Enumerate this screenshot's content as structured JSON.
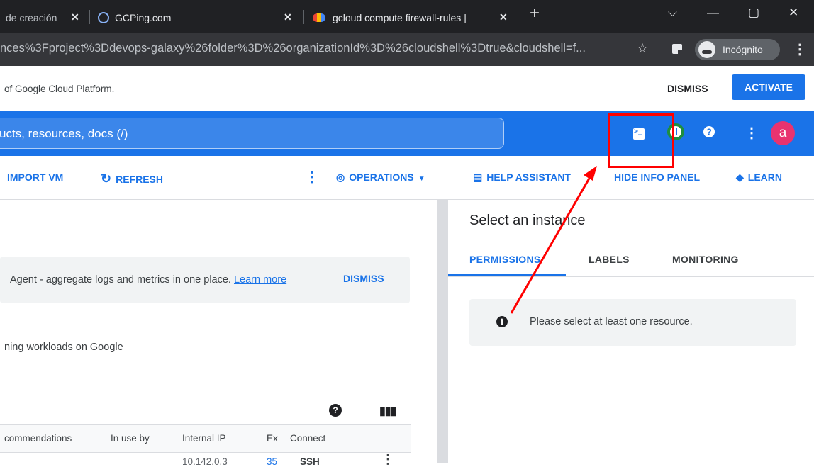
{
  "browser": {
    "tabs": [
      {
        "title": "de creación",
        "close": "✕"
      },
      {
        "title": "GCPing.com",
        "close": "✕"
      },
      {
        "title": "gcloud compute firewall-rules |",
        "close": "✕"
      }
    ],
    "new_tab": "+",
    "window_controls": {
      "minimize": "—",
      "maximize": "▢",
      "close": "✕",
      "dropdown": "⌵"
    },
    "url": "nces%3Fproject%3Ddevops-galaxy%26folder%3D%26organizationId%3D%26cloudshell%3Dtrue&cloudshell=f...",
    "incognito_label": "Incógnito"
  },
  "banner": {
    "text": "of Google Cloud Platform.",
    "dismiss": "DISMISS",
    "activate": "ACTIVATE"
  },
  "header": {
    "search_text": "ucts, resources, docs (/)",
    "help_glyph": "?",
    "avatar_letter": "a"
  },
  "toolbar": {
    "import_vm": "IMPORT VM",
    "refresh": "REFRESH",
    "operations": "OPERATIONS",
    "help_assistant": "HELP ASSISTANT",
    "hide_info_panel": "HIDE INFO PANEL",
    "learn": "LEARN"
  },
  "main": {
    "infobar_text": "Agent - aggregate logs and metrics in one place.",
    "infobar_link": "Learn more",
    "infobar_dismiss": "DISMISS",
    "description": "ning workloads on Google",
    "table_headers": [
      "commendations",
      "In use by",
      "Internal IP",
      "Ex",
      "Connect"
    ],
    "partial_row": [
      "10.142.0.3",
      "35",
      "SSH"
    ]
  },
  "panel": {
    "title": "Select an instance",
    "tabs": [
      "PERMISSIONS",
      "LABELS",
      "MONITORING"
    ],
    "notice": "Please select at least one resource."
  },
  "colors": {
    "brand_blue": "#1a73e8",
    "annotation_red": "#ff0000"
  }
}
